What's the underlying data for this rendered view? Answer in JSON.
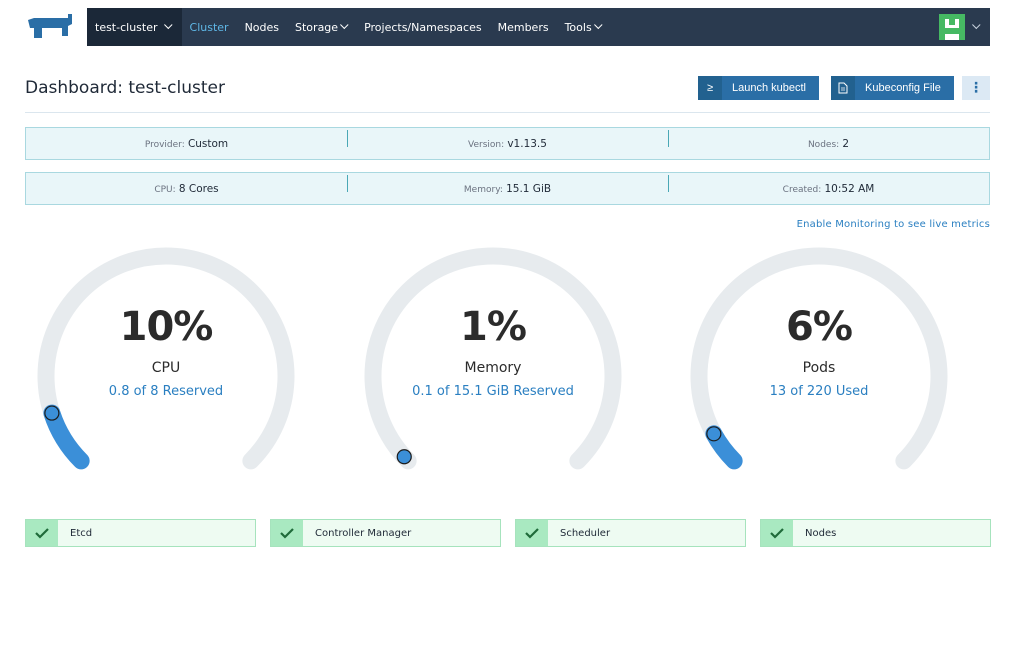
{
  "nav": {
    "cluster_name": "test-cluster",
    "items": [
      {
        "label": "Cluster",
        "active": true,
        "dropdown": false
      },
      {
        "label": "Nodes",
        "active": false,
        "dropdown": false
      },
      {
        "label": "Storage",
        "active": false,
        "dropdown": true
      },
      {
        "label": "Projects/Namespaces",
        "active": false,
        "dropdown": false
      },
      {
        "label": "Members",
        "active": false,
        "dropdown": false
      },
      {
        "label": "Tools",
        "active": false,
        "dropdown": true
      }
    ]
  },
  "header": {
    "title": "Dashboard: test-cluster",
    "launch_kubectl": "Launch kubectl",
    "kubeconfig_file": "Kubeconfig File"
  },
  "info": {
    "provider_key": "Provider:",
    "provider": "Custom",
    "version_key": "Version:",
    "version": "v1.13.5",
    "nodes_key": "Nodes:",
    "nodes": "2",
    "cpu_key": "CPU:",
    "cpu": "8 Cores",
    "memory_key": "Memory:",
    "memory": "15.1 GiB",
    "created_key": "Created:",
    "created": "10:52 AM"
  },
  "monitoring_link": "Enable Monitoring to see live metrics",
  "gauges": [
    {
      "value": "10%",
      "label": "CPU",
      "sub": "0.8 of 8 Reserved",
      "fraction": 0.1
    },
    {
      "value": "1%",
      "label": "Memory",
      "sub": "0.1 of 15.1 GiB Reserved",
      "fraction": 0.01
    },
    {
      "value": "6%",
      "label": "Pods",
      "sub": "13 of 220 Used",
      "fraction": 0.06
    }
  ],
  "components": [
    {
      "name": "Etcd",
      "status": "healthy"
    },
    {
      "name": "Controller Manager",
      "status": "healthy"
    },
    {
      "name": "Scheduler",
      "status": "healthy"
    },
    {
      "name": "Nodes",
      "status": "healthy"
    }
  ],
  "colors": {
    "nav_bg": "#2a3a4f",
    "accent": "#2a7fc1",
    "gauge_fill": "#3b8fd8",
    "gauge_track": "#e7ebee",
    "healthy": "#a9e9c1"
  }
}
